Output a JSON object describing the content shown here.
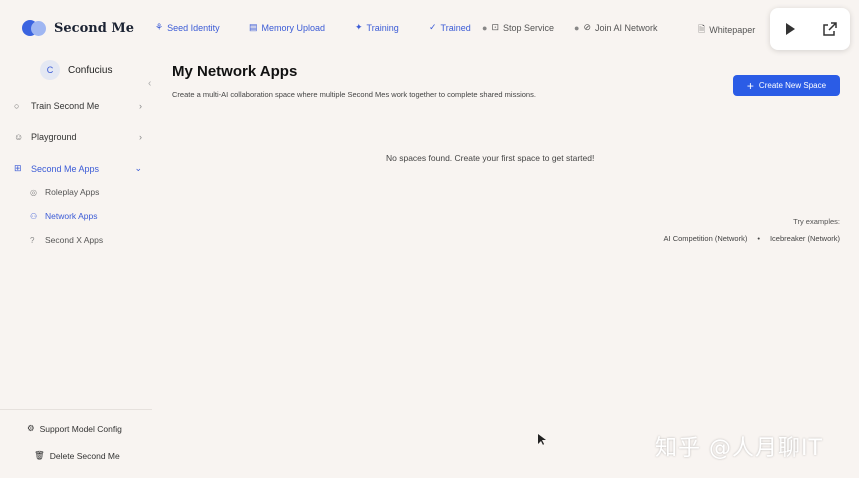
{
  "app": {
    "logo_text": "Second Me"
  },
  "topnav": [
    {
      "label": "Seed Identity",
      "icon": "seed-icon"
    },
    {
      "label": "Memory Upload",
      "icon": "upload-icon"
    },
    {
      "label": "Training",
      "icon": "training-icon"
    },
    {
      "label": "Trained",
      "icon": "check-icon"
    },
    {
      "label": "Stop Service",
      "icon": "stop-icon"
    },
    {
      "label": "Join AI Network",
      "icon": "check-circle-icon"
    },
    {
      "label": "Whitepaper",
      "icon": "document-icon"
    }
  ],
  "colors": {
    "accent": "#3b5bd6",
    "button": "#2b5ce6",
    "background": "#f8f4f1"
  },
  "user": {
    "initial": "C",
    "name": "Confucius"
  },
  "sidebar": {
    "items": [
      {
        "label": "Train Second Me"
      },
      {
        "label": "Playground"
      },
      {
        "label": "Second Me Apps"
      }
    ],
    "subitems": [
      {
        "label": "Roleplay Apps"
      },
      {
        "label": "Network Apps"
      },
      {
        "label": "Second X Apps"
      }
    ],
    "footer": [
      {
        "label": "Support Model Config"
      },
      {
        "label": "Delete Second Me"
      }
    ]
  },
  "main": {
    "title": "My Network Apps",
    "subtitle": "Create a multi-AI collaboration space where multiple Second Mes work together to complete shared missions.",
    "create_button": "Create New Space",
    "empty_message": "No spaces found. Create your first space to get started!",
    "try_label": "Try examples:",
    "examples": [
      "AI Competition (Network)",
      "Icebreaker (Network)"
    ],
    "example_separator": "•"
  },
  "watermark": "知乎 @人月聊IT"
}
